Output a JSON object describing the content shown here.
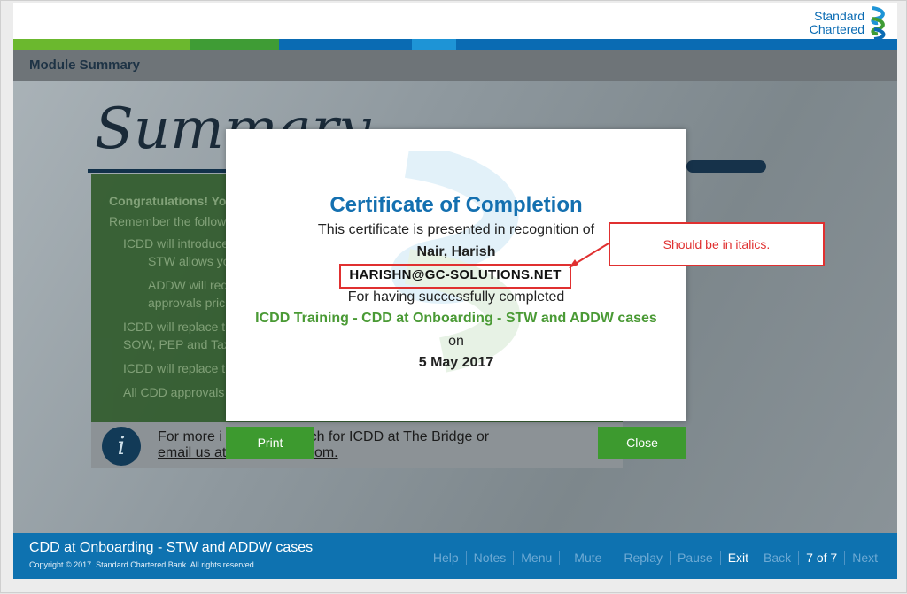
{
  "brand": {
    "line1": "Standard",
    "line2": "Chartered",
    "logo_icon": "sc-logo-icon"
  },
  "stripe_colors": [
    "#6bb82e",
    "#3f9c35",
    "#0a6bb3",
    "#1e94d6",
    "#0a6bb3"
  ],
  "module": {
    "title": "Module Summary",
    "bg_word": "Summary"
  },
  "green_panel": {
    "heading": "Congratulations! Yo",
    "intro": "Remember the follow",
    "bullets": [
      "ICDD will introduce",
      "STW allows yo",
      "ADDW will req",
      "approvals pric",
      "ICDD will replace t",
      "SOW, PEP and Tax",
      "ICDD will replace t",
      "All CDD approvals"
    ]
  },
  "info": {
    "icon": "info-icon",
    "line1": "For more i                   arch for ICDD at The Bridge or",
    "line2": "email us at                sc.com."
  },
  "certificate": {
    "title": "Certificate of Completion",
    "presented": "This certificate is presented in recognition of",
    "name": "Nair, Harish",
    "email": "HARISHN@GC-SOLUTIONS.NET",
    "completed": "For having successfully completed",
    "course": "ICDD Training - CDD at Onboarding - STW and ADDW cases",
    "on": "on",
    "date": "5 May 2017",
    "print_label": "Print",
    "close_label": "Close"
  },
  "annotation": {
    "text": "Should be in italics."
  },
  "footer": {
    "course_title": "CDD at Onboarding - STW and ADDW cases",
    "copyright": "Copyright © 2017. Standard Chartered Bank. All rights reserved.",
    "nav": {
      "help": "Help",
      "notes": "Notes",
      "menu": "Menu",
      "mute": "Mute",
      "replay": "Replay",
      "pause": "Pause",
      "exit": "Exit",
      "back": "Back",
      "page": "7 of 7",
      "next": "Next"
    }
  }
}
